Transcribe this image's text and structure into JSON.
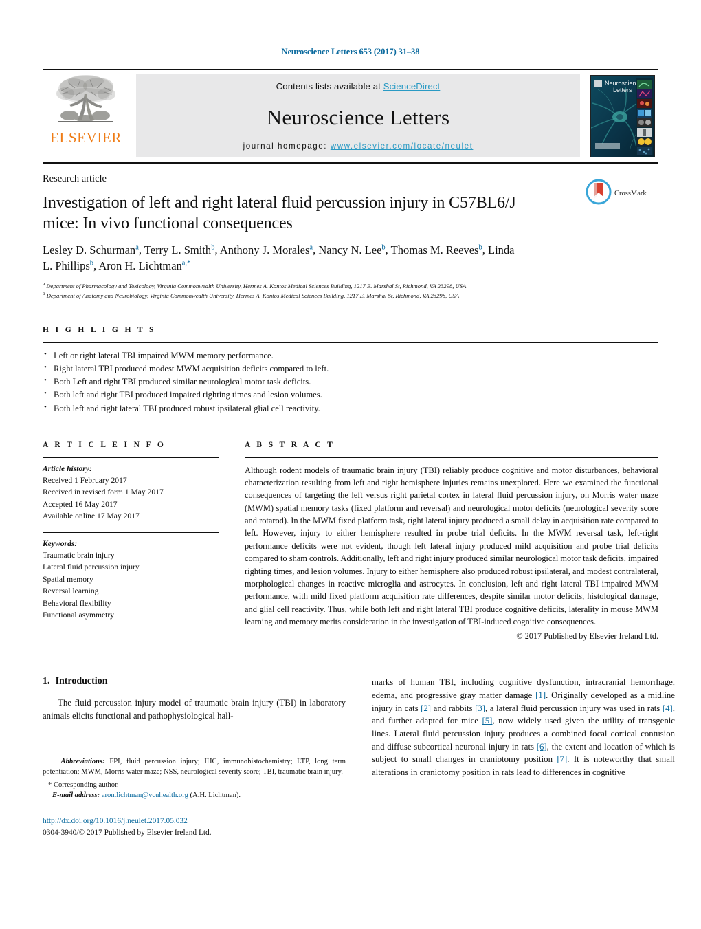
{
  "running_head": "Neuroscience Letters 653 (2017) 31–38",
  "masthead": {
    "publisher_name": "ELSEVIER",
    "publisher_logo_icon": "elsevier-tree-icon",
    "banner_contents_prefix": "Contents lists available at ",
    "banner_contents_link": "ScienceDirect",
    "journal_title": "Neuroscience Letters",
    "homepage_prefix": "journal homepage: ",
    "homepage_url": "www.elsevier.com/locate/neulet",
    "cover_icon": "journal-cover-thumbnail",
    "cover_title_line1": "Neuroscience",
    "cover_title_line2": "Letters"
  },
  "article": {
    "kicker": "Research article",
    "title": "Investigation of left and right lateral fluid percussion injury in C57BL6/J mice: In vivo functional consequences",
    "crossmark_label": "CrossMark",
    "crossmark_icon": "crossmark-icon",
    "authors": [
      {
        "name": "Lesley D. Schurman",
        "sup": "a",
        "sep": ", "
      },
      {
        "name": "Terry L. Smith",
        "sup": "b",
        "sep": ", "
      },
      {
        "name": "Anthony J. Morales",
        "sup": "a",
        "sep": ", "
      },
      {
        "name": "Nancy N. Lee",
        "sup": "b",
        "sep": ", "
      },
      {
        "name": "Thomas M. Reeves",
        "sup": "b",
        "sep": ", "
      },
      {
        "name": "Linda L. Phillips",
        "sup": "b",
        "sep": ", "
      },
      {
        "name": "Aron H. Lichtman",
        "sup": "a,*",
        "sep": ""
      }
    ],
    "affiliations": [
      {
        "marker": "a",
        "text": "Department of Pharmacology and Toxicology, Virginia Commonwealth University, Hermes A. Kontos Medical Sciences Building, 1217 E. Marshal St, Richmond, VA 23298, USA"
      },
      {
        "marker": "b",
        "text": "Department of Anatomy and Neurobiology, Virginia Commonwealth University, Hermes A. Kontos Medical Sciences Building, 1217 E. Marshal St, Richmond, VA 23298, USA"
      }
    ]
  },
  "highlights": {
    "label": "H I G H L I G H T S",
    "items": [
      "Left or right lateral TBI impaired MWM memory performance.",
      "Right lateral TBI produced modest MWM acquisition deficits compared to left.",
      "Both Left and right TBI produced similar neurological motor task deficits.",
      "Both left and right TBI produced impaired righting times and lesion volumes.",
      "Both left and right lateral TBI produced robust ipsilateral glial cell reactivity."
    ]
  },
  "article_info": {
    "label": "A R T I C L E   I N F O",
    "history_title": "Article history:",
    "history": [
      "Received 1 February 2017",
      "Received in revised form 1 May 2017",
      "Accepted 16 May 2017",
      "Available online 17 May 2017"
    ],
    "keywords_title": "Keywords:",
    "keywords": [
      "Traumatic brain injury",
      "Lateral fluid percussion injury",
      "Spatial memory",
      "Reversal learning",
      "Behavioral flexibility",
      "Functional asymmetry"
    ]
  },
  "abstract": {
    "label": "A B S T R A C T",
    "text": "Although rodent models of traumatic brain injury (TBI) reliably produce cognitive and motor disturbances, behavioral characterization resulting from left and right hemisphere injuries remains unexplored. Here we examined the functional consequences of targeting the left versus right parietal cortex in lateral fluid percussion injury, on Morris water maze (MWM) spatial memory tasks (fixed platform and reversal) and neurological motor deficits (neurological severity score and rotarod). In the MWM fixed platform task, right lateral injury produced a small delay in acquisition rate compared to left. However, injury to either hemisphere resulted in probe trial deficits. In the MWM reversal task, left-right performance deficits were not evident, though left lateral injury produced mild acquisition and probe trial deficits compared to sham controls. Additionally, left and right injury produced similar neurological motor task deficits, impaired righting times, and lesion volumes. Injury to either hemisphere also produced robust ipsilateral, and modest contralateral, morphological changes in reactive microglia and astrocytes. In conclusion, left and right lateral TBI impaired MWM performance, with mild fixed platform acquisition rate differences, despite similar motor deficits, histological damage, and glial cell reactivity. Thus, while both left and right lateral TBI produce cognitive deficits, laterality in mouse MWM learning and memory merits consideration in the investigation of TBI-induced cognitive consequences.",
    "copyright": "© 2017 Published by Elsevier Ireland Ltd."
  },
  "body": {
    "section_number": "1.",
    "section_title": "Introduction",
    "left_para": "The fluid percussion injury model of traumatic brain injury (TBI) in laboratory animals elicits functional and pathophysiological hall-",
    "right_para_parts": [
      {
        "t": "marks of human TBI, including cognitive dysfunction, intracranial hemorrhage, edema, and progressive gray matter damage ",
        "ref": false
      },
      {
        "t": "[1]",
        "ref": true
      },
      {
        "t": ". Originally developed as a midline injury in cats ",
        "ref": false
      },
      {
        "t": "[2]",
        "ref": true
      },
      {
        "t": " and rabbits ",
        "ref": false
      },
      {
        "t": "[3]",
        "ref": true
      },
      {
        "t": ", a lateral fluid percussion injury was used in rats ",
        "ref": false
      },
      {
        "t": "[4]",
        "ref": true
      },
      {
        "t": ", and further adapted for mice ",
        "ref": false
      },
      {
        "t": "[5]",
        "ref": true
      },
      {
        "t": ", now widely used given the utility of transgenic lines. Lateral fluid percussion injury produces a combined focal cortical contusion and diffuse subcortical neuronal injury in rats ",
        "ref": false
      },
      {
        "t": "[6]",
        "ref": true
      },
      {
        "t": ", the extent and location of which is subject to small changes in craniotomy position ",
        "ref": false
      },
      {
        "t": "[7]",
        "ref": true
      },
      {
        "t": ". It is noteworthy that small alterations in craniotomy position in rats lead to differences in cognitive",
        "ref": false
      }
    ]
  },
  "footnotes": {
    "abbrev_label": "Abbreviations:",
    "abbrev_text": "FPI, fluid percussion injury; IHC, immunohistochemistry; LTP, long term potentiation; MWM, Morris water maze; NSS, neurological severity score; TBI, traumatic brain injury.",
    "corresponding": "* Corresponding author.",
    "email_label": "E-mail address:",
    "email": "aron.lichtman@vcuhealth.org",
    "email_suffix": "(A.H. Lichtman).",
    "doi": "http://dx.doi.org/10.1016/j.neulet.2017.05.032",
    "issn_line": "0304-3940/© 2017 Published by Elsevier Ireland Ltd."
  },
  "colors": {
    "link": "#0b6a9e",
    "sciencedirect": "#2a9ac4",
    "elsevier_orange": "#ef7c16",
    "banner_bg": "#e8e8e9"
  }
}
